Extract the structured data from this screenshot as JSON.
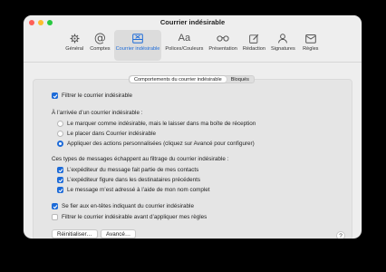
{
  "window": {
    "title": "Courrier indésirable"
  },
  "toolbar": {
    "items": [
      {
        "label": "Général",
        "icon": "gear-icon"
      },
      {
        "label": "Comptes",
        "icon": "at-icon"
      },
      {
        "label": "Courrier indésirable",
        "icon": "junk-tray-icon",
        "selected": true
      },
      {
        "label": "Polices/Couleurs",
        "icon": "font-icon"
      },
      {
        "label": "Présentation",
        "icon": "glasses-icon"
      },
      {
        "label": "Rédaction",
        "icon": "compose-icon"
      },
      {
        "label": "Signatures",
        "icon": "signature-icon"
      },
      {
        "label": "Règles",
        "icon": "rules-icon"
      }
    ]
  },
  "tabs": {
    "behavior": "Comportements du courrier indésirable",
    "blocked": "Bloqués"
  },
  "settings": {
    "enable_filter": "Filtrer le courrier indésirable",
    "on_arrival_heading": "À l’arrivée d’un courrier indésirable :",
    "radio_mark": "Le marquer comme indésirable, mais le laisser dans ma boîte de réception",
    "radio_move": "Le placer dans Courrier indésirable",
    "radio_custom": "Appliquer des actions personnalisées (cliquez sur Avancé pour configurer)",
    "exempt_heading": "Ces types de messages échappent au filtrage du courrier indésirable :",
    "exempt_contacts": "L’expéditeur du message fait partie de mes contacts",
    "exempt_previous": "L’expéditeur figure dans les destinataires précédents",
    "exempt_fullname": "Le message m’est adressé à l’aide de mon nom complet",
    "trust_headers": "Se fier aux en-têtes indiquant du courrier indésirable",
    "filter_before_rules": "Filtrer le courrier indésirable avant d’appliquer mes règles"
  },
  "buttons": {
    "reset": "Réinitialiser…",
    "advanced": "Avancé…",
    "help": "?"
  },
  "colors": {
    "accent": "#1d6bd8",
    "window_bg": "#eeeeee",
    "panel_bg": "#e5e5e5"
  }
}
